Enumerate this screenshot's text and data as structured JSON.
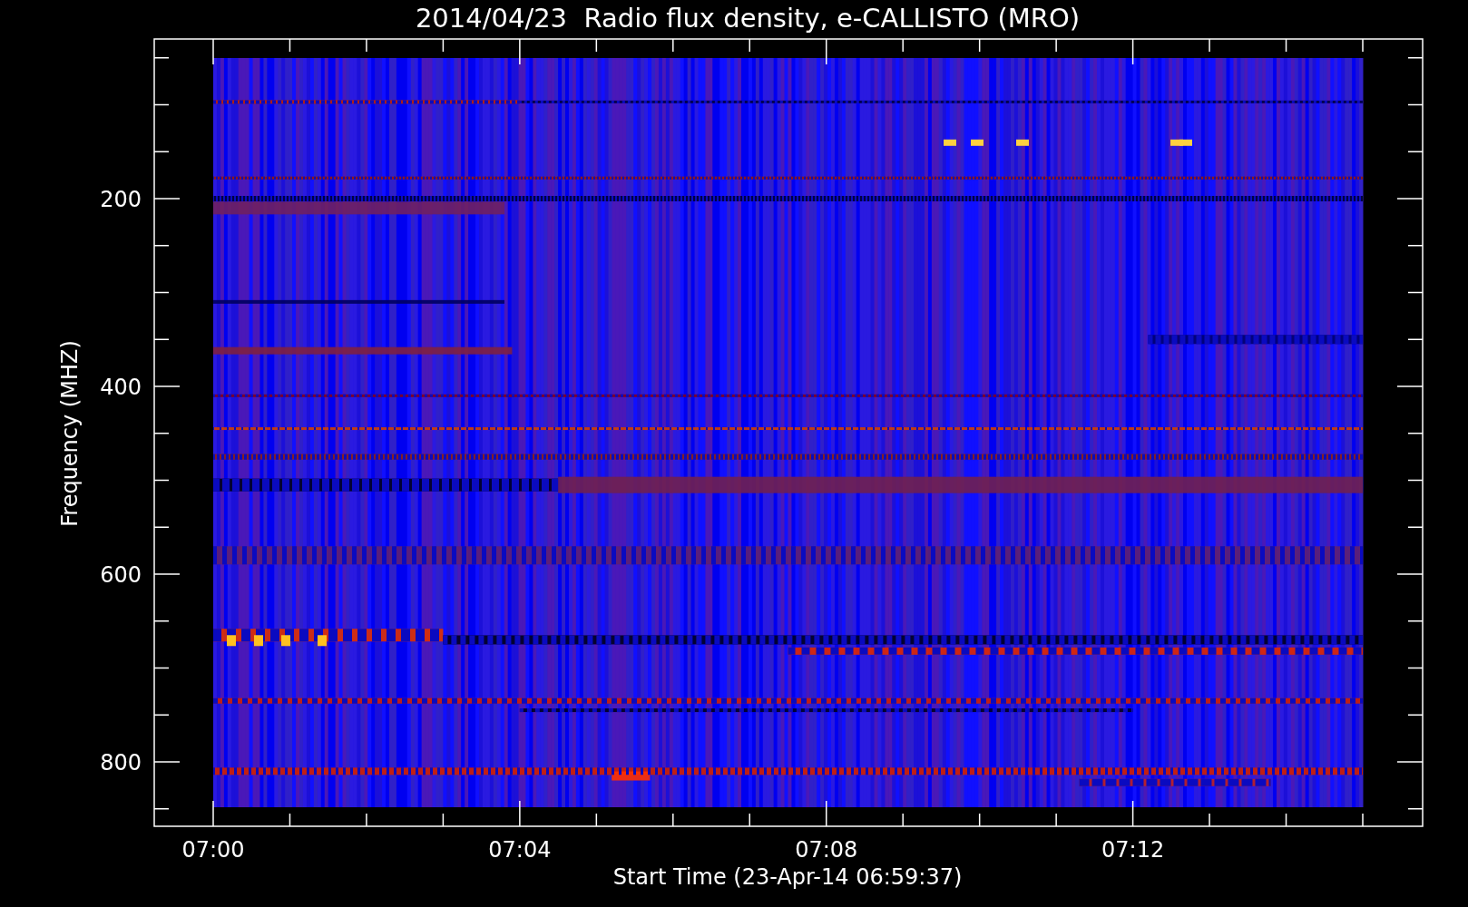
{
  "title": "2014/04/23  Radio flux density, e-CALLISTO (MRO)",
  "y_axis": {
    "label": "Frequency (MHZ)",
    "ticks": [
      "200",
      "400",
      "600",
      "800"
    ]
  },
  "x_axis": {
    "label": "Start Time (23-Apr-14 06:59:37)",
    "ticks": [
      "07:00",
      "07:04",
      "07:08",
      "07:12"
    ]
  }
}
